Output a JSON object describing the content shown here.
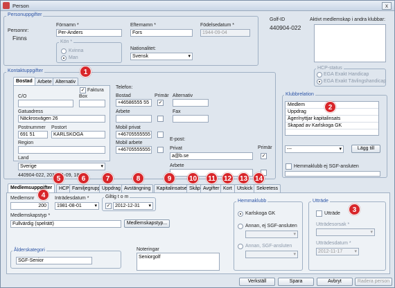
{
  "window": {
    "title": "Person",
    "close": "x"
  },
  "personal": {
    "group_label": "Personuppgifter",
    "personnr_label": "Personnr:",
    "personnr_value": "Finns",
    "fornamn_label": "Förnamn *",
    "fornamn_value": "Per-Anders",
    "efternamn_label": "Efternamn *",
    "efternamn_value": "Fors",
    "fodelsedatum_label": "Födelsedatum *",
    "fodelsedatum_value": "1944-09-04",
    "kon_label": "Kön *",
    "kon_options": [
      "Kvinna",
      "Man"
    ],
    "nationalitet_label": "Nationalitet:",
    "nationalitet_value": "Svensk"
  },
  "golf": {
    "golfid_label": "Golf-ID",
    "golfid_value": "440904-022",
    "aktivt_label": "Aktivt medlemskap i andra klubbar:"
  },
  "hcp_status": {
    "label": "HCP-status",
    "options": [
      "EGA Exakt Handicap",
      "EGA Exakt Tävlingshandicap"
    ]
  },
  "kontakt": {
    "group_label": "Kontaktuppgifter",
    "tabs": [
      "Bostad",
      "Arbete",
      "Alternativ"
    ],
    "faktura_label": "Faktura",
    "co_label": "C/O",
    "box_label": "Box",
    "gatuadress_label": "Gatuadress",
    "gatuadress_value": "Näckrosvägen 26",
    "postnummer_label": "Postnummer",
    "postnummer_value": "691 51",
    "postort_label": "Postort",
    "postort_value": "KARLSKOGA",
    "region_label": "Region",
    "land_label": "Land",
    "land_value": "Sverige",
    "footer_text": "440904-022, 2011-01-09, 18:..."
  },
  "telefon": {
    "label": "Telefon:",
    "bostad_label": "Bostad",
    "bostad_value": "+46586555 55",
    "primar_label": "Primär",
    "alternativ_label": "Alternativ",
    "arbete_label": "Arbete",
    "fax_label": "Fax",
    "mobil_privat_label": "Mobil privat",
    "mobil_privat_value": "+46705555555",
    "mobil_arbete_label": "Mobil arbete",
    "mobil_arbete_value": "+46705555555"
  },
  "epost": {
    "label": "E-post:",
    "privat_label": "Privat",
    "privat_value": "a@b.se",
    "primar_label": "Primär",
    "arbete_label": "Arbete"
  },
  "klubbrelation": {
    "label": "Klubbrelation",
    "items": [
      "Medlem",
      "Uppdrag",
      "Äger/nyttjar kapitalinsats",
      "Skapad av Karlskoga GK"
    ],
    "select_value": "---",
    "add_button": "Lägg till",
    "hemmaklubb_label": "Hemmaklubb ej SGF-ansluten"
  },
  "main_tabs": [
    "Medlemsuppgifter",
    "HCP",
    "Familjegrupp",
    "Uppdrag",
    "Avstängning",
    "Kapitalinsatser",
    "Skåp",
    "Avgifter",
    "Kort",
    "Utskick",
    "Sekretess"
  ],
  "medlem": {
    "medlemsnr_label": "Medlemsnr",
    "medlemsnr_value": "200",
    "intradesdatum_label": "Inträdesdatum *",
    "intradesdatum_value": "1981-08-01",
    "giltig_label": "Giltig t o m",
    "giltig_value": "2012-12-31",
    "medlemskapstyp_label": "Medlemskapstyp *",
    "medlemskapstyp_value": "Fullvärdig (spelrätt)",
    "medlemskapstyp_button": "Medlemskapstyp...",
    "alderskategori_label": "Ålderskategori",
    "alderskategori_value": "SGF-Senior",
    "noteringar_label": "Noteringar",
    "noteringar_value": "Seniorgolf"
  },
  "hemmaklubb": {
    "label": "Hemmaklubb",
    "options": [
      "Karlskoga GK",
      "Annan, ej SGF-ansluten",
      "Annan, SGF-ansluten"
    ]
  },
  "uttrade": {
    "label": "Utträde",
    "checkbox_label": "Utträde",
    "orsak_label": "Utträdesorsak *",
    "datum_label": "Utträdesdatum *",
    "datum_value": "2012-11-17"
  },
  "footer_buttons": [
    "Verkställ",
    "Spara",
    "Avbryt",
    "Radera person"
  ],
  "badges": [
    "1",
    "2",
    "3",
    "4",
    "5",
    "6",
    "7",
    "8",
    "9",
    "10",
    "11",
    "12",
    "13",
    "14"
  ],
  "colors": {
    "badge": "#d8262a",
    "accent_text": "#2d55a6",
    "window_bg": "#dfe6ee"
  }
}
